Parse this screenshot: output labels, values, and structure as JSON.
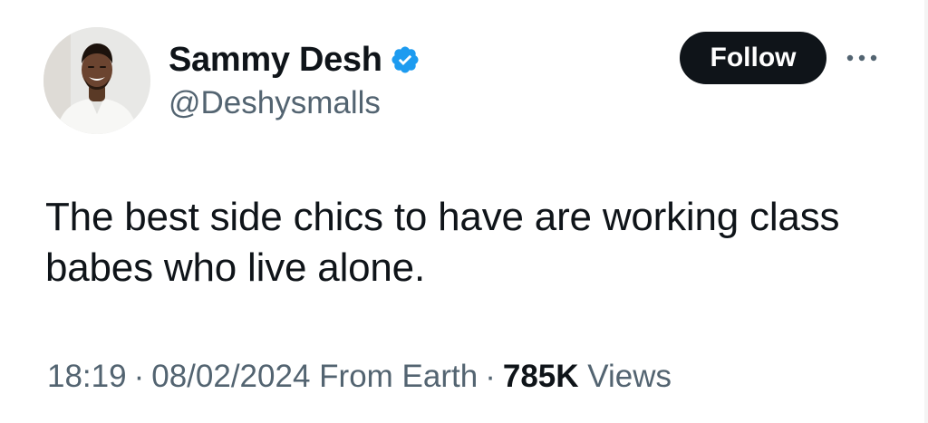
{
  "author": {
    "display_name": "Sammy Desh",
    "handle": "@Deshysmalls",
    "verified": true,
    "verified_badge_color": "#1d9bf0"
  },
  "actions": {
    "follow_label": "Follow",
    "more_icon": "ellipsis-icon"
  },
  "tweet": {
    "text": "The best side chics to have are working class babes who live alone."
  },
  "meta": {
    "time": "18:19",
    "date": "08/02/2024",
    "source": "From Earth",
    "views_count": "785K",
    "views_label": "Views",
    "separator": "·"
  },
  "colors": {
    "text_primary": "#0f1419",
    "text_secondary": "#536471",
    "button_bg": "#0f1419",
    "button_text": "#ffffff"
  }
}
